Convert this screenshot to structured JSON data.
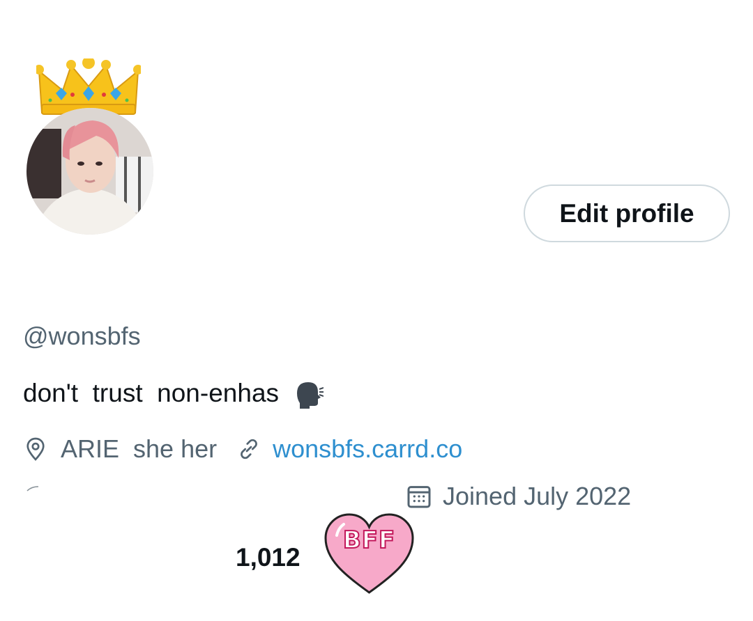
{
  "profile": {
    "handle": "@wonsbfs",
    "bio": "don't  trust  non-enhas",
    "location": "ARIE  she her",
    "website": "wonsbfs.carrd.co",
    "joined": "Joined July 2022",
    "count": "1,012",
    "edit_label": "Edit profile",
    "badge_text": "BFF"
  },
  "icons": {
    "crown": "crown-icon",
    "speak": "speaking-head-icon",
    "location": "location-pin-icon",
    "link": "link-icon",
    "calendar": "calendar-icon",
    "heart": "heart-sticker-icon"
  },
  "colors": {
    "text": "#0f1419",
    "secondary": "#536471",
    "link": "#2e8fcf",
    "border": "#cfd9de",
    "heart_fill": "#f7a9c9",
    "heart_stroke": "#c2185b",
    "crown": "#f7c21b"
  }
}
